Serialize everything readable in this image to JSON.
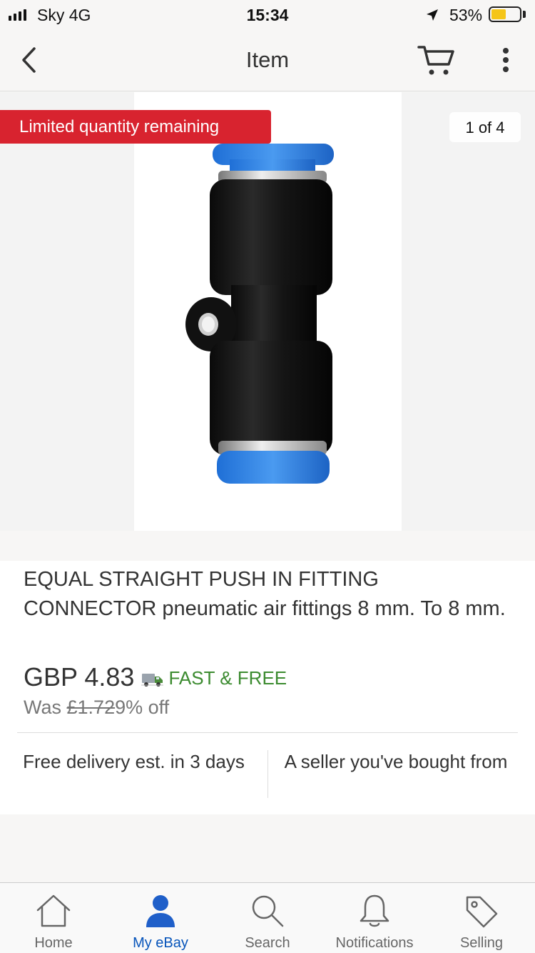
{
  "status_bar": {
    "carrier": "Sky  4G",
    "time": "15:34",
    "battery_percent": "53%",
    "battery_level": 0.53,
    "signal_bars": 4
  },
  "nav": {
    "title": "Item",
    "back_icon": "chevron-left-icon",
    "cart_icon": "cart-icon",
    "more_icon": "more-vertical-icon"
  },
  "gallery": {
    "banner": "Limited quantity remaining",
    "counter": "1 of 4"
  },
  "product": {
    "title": "EQUAL STRAIGHT PUSH IN FITTING CONNECTOR pneumatic air fittings 8 mm. To 8 mm.",
    "price": "GBP 4.83",
    "shipping": "FAST & FREE",
    "was_label": "Was",
    "was_price": "£1.72",
    "discount": "9% off",
    "delivery": "Free delivery est. in 3 days",
    "seller_note": "A seller you've bought from"
  },
  "tabs": [
    {
      "label": "Home",
      "icon": "home-icon"
    },
    {
      "label": "My eBay",
      "icon": "person-icon",
      "active": true
    },
    {
      "label": "Search",
      "icon": "search-icon"
    },
    {
      "label": "Notifications",
      "icon": "bell-icon"
    },
    {
      "label": "Selling",
      "icon": "tag-icon"
    }
  ],
  "colors": {
    "banner": "#d8232f",
    "shipping_green": "#3c8b30",
    "active_tab": "#0654ba"
  }
}
